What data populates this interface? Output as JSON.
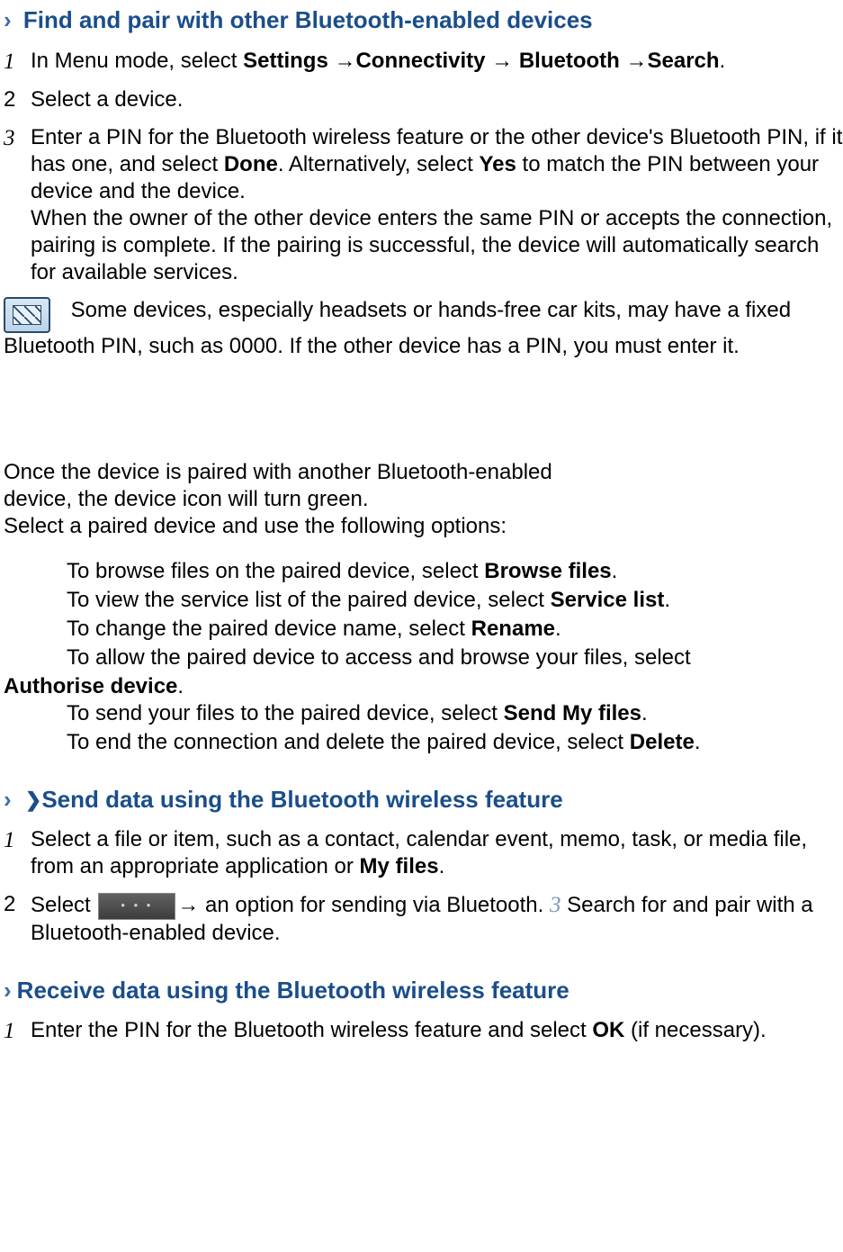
{
  "chevron": "›",
  "section1": {
    "title": "Find and pair with other Bluetooth-enabled devices",
    "steps": [
      {
        "num": "1",
        "italic": true,
        "parts": [
          "In Menu mode, select ",
          "Settings ",
          "→",
          "Connectivity ",
          "→ ",
          "Bluetooth ",
          "→",
          "Search",
          "."
        ]
      },
      {
        "num": "2",
        "italic": false,
        "text": "Select a device."
      },
      {
        "num": "3",
        "italic": true,
        "para1": [
          "Enter a PIN for the Bluetooth wireless feature or the other device's Bluetooth PIN, if it has one, and select ",
          "Done",
          ". Alternatively, select ",
          "Yes",
          " to match the PIN between your device and the device."
        ],
        "para2": "When the owner of the other device enters the same PIN or accepts the connection, pairing is complete. If the pairing is successful, the device will automatically search for available services."
      }
    ],
    "note": "Some devices, especially headsets or hands-free car kits, may have a fixed Bluetooth PIN, such as 0000. If the other device has a PIN, you must enter it."
  },
  "pairedBlock": {
    "line1": "Once the device is paired with another Bluetooth-enabled",
    "line2": "device, the device icon will turn green.",
    "line3": "Select a paired device and use the following options:",
    "options": [
      {
        "pre": "To browse files on the paired device, select ",
        "bold": "Browse files",
        "post": "."
      },
      {
        "pre": "To view the service list of the paired device, select ",
        "bold": "Service list",
        "post": "."
      },
      {
        "pre": "To change the paired device name, select ",
        "bold": "Rename",
        "post": "."
      },
      {
        "pre": "To allow the paired device to access and browse your files, select ",
        "boldWrap": "Authorise device",
        "postWrap": "."
      },
      {
        "pre": "To send your files to the paired device, select ",
        "bold": "Send My files",
        "post": "."
      },
      {
        "pre": "To end the connection and delete the paired device, select ",
        "bold": "Delete",
        "post": "."
      }
    ]
  },
  "section2": {
    "bulletGlyph": "❯",
    "title": "Send data using the Bluetooth wireless feature",
    "steps": [
      {
        "num": "1",
        "italic": true,
        "parts": [
          "Select a file or item, such as a contact, calendar event, memo, task, or media file, from an appropriate application or ",
          "My files",
          "."
        ]
      },
      {
        "num": "2",
        "italic": false,
        "pre": "Select  ",
        "mid": "→ an option for sending via Bluetooth. ",
        "inlineNum": "3",
        "tail": " Search for and pair with a Bluetooth-enabled device."
      }
    ]
  },
  "section3": {
    "title": "Receive data using the Bluetooth wireless feature",
    "steps": [
      {
        "num": "1",
        "italic": true,
        "parts": [
          "Enter the PIN for the Bluetooth wireless feature and select ",
          "OK",
          " (if necessary)."
        ]
      }
    ]
  }
}
